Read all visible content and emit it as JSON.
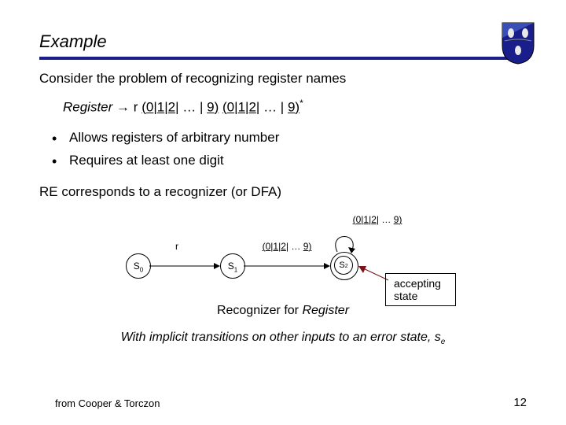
{
  "title": "Example",
  "intro": "Consider the problem of recognizing  register names",
  "grammar": {
    "lhs": "Register",
    "arrow": "→",
    "r": "r",
    "group1a": "(",
    "d0": "0",
    "bar": "|",
    "d1": "1",
    "d2": "2",
    "dots": " … | ",
    "d9": "9",
    "group1b": ")",
    "group2a": "(",
    "group2b": ")",
    "star": "*"
  },
  "bullets": [
    "Allows registers of arbitrary number",
    "Requires at least one digit"
  ],
  "re_line": {
    "pre": "RE",
    "mid": " corresponds to a recognizer (or ",
    "dfa": "DFA",
    "post": ")"
  },
  "dfa": {
    "s0": "S",
    "s0sub": "0",
    "s1": "S",
    "s1sub": "1",
    "s2": "S",
    "s2sub": "2",
    "edge_r": "r",
    "edge_digits_a": "(",
    "edge_digits_0": "0",
    "edge_bar": "|",
    "edge_digits_1": "1",
    "edge_digits_2": "2",
    "edge_dots": " … ",
    "edge_digits_9": "9",
    "edge_digits_b": ")",
    "accept_label": "accepting state"
  },
  "caption_pre": "Recognizer for ",
  "caption_it": "Register",
  "note_text": "With implicit transitions on other inputs to an error state, s",
  "note_sub": "e",
  "footer": "from Cooper & Torczon",
  "page": "12"
}
